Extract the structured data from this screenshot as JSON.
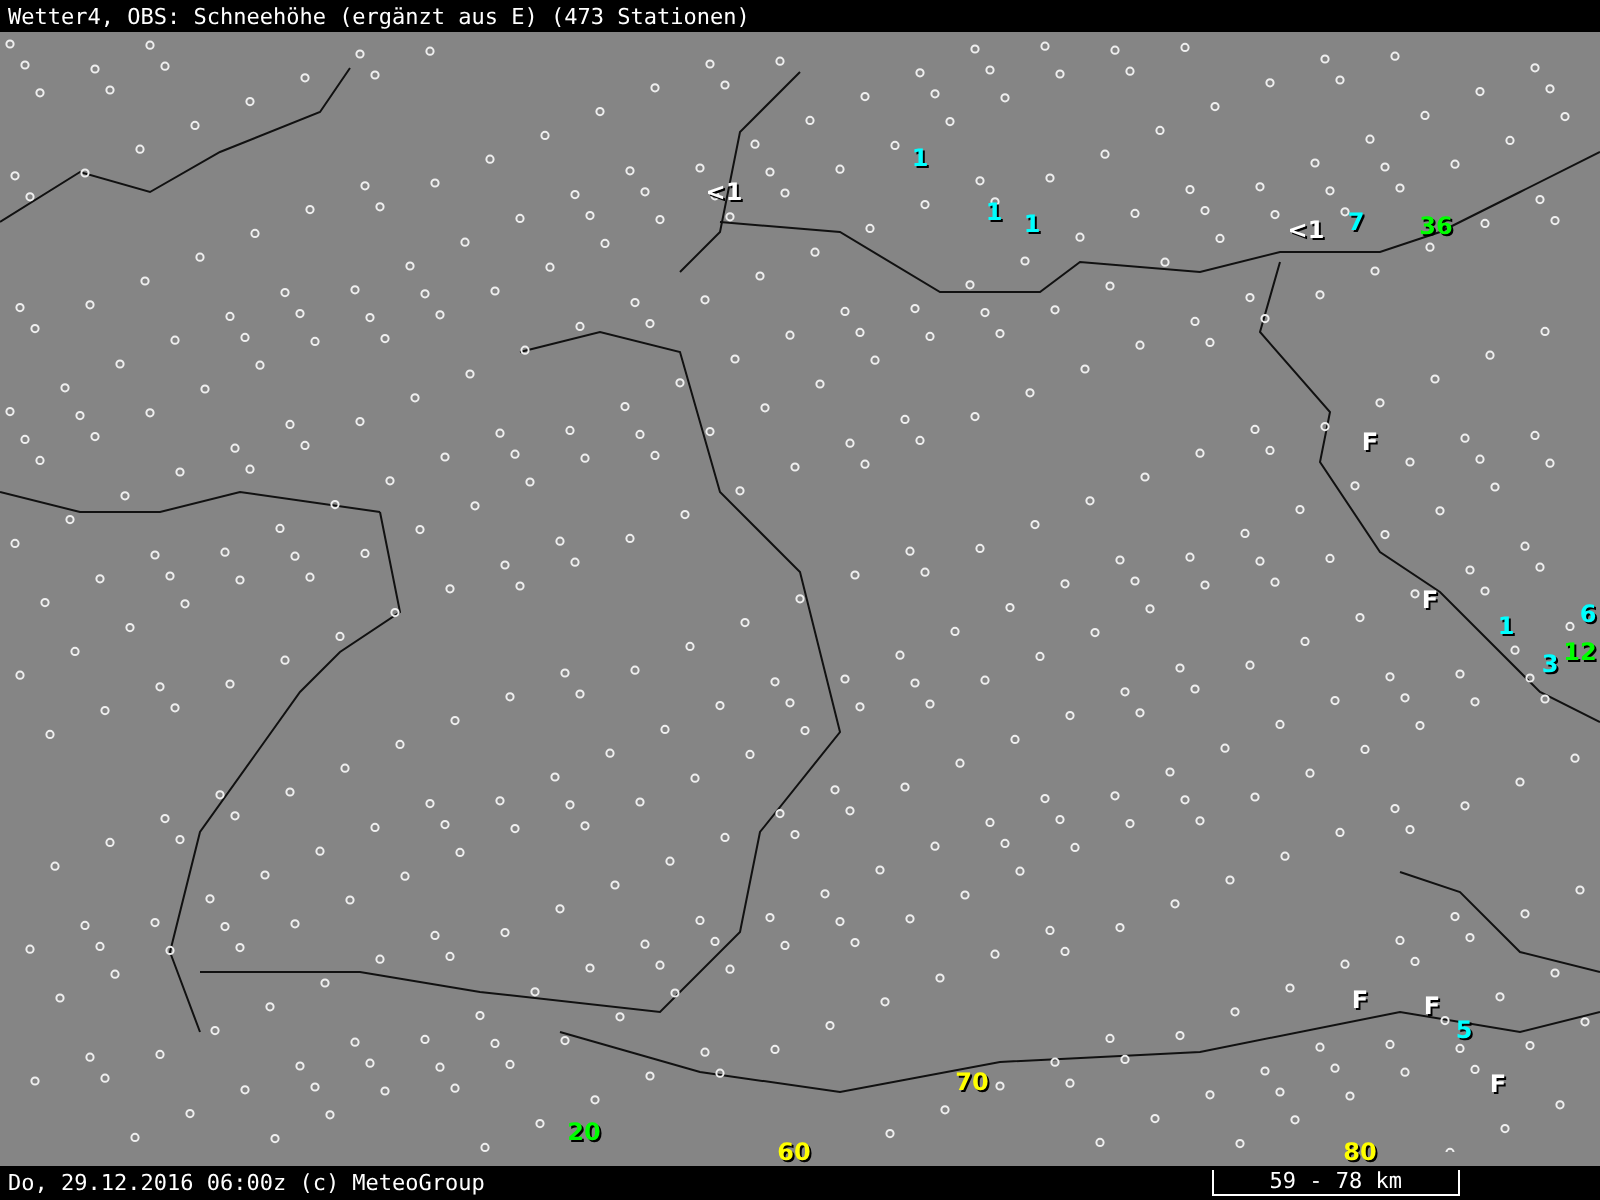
{
  "title_bar": {
    "title": "Wetter4, OBS: Schneehöhe (ergänzt aus E) (473 Stationen)"
  },
  "map": {
    "snow_labels": [
      {
        "text": "<1",
        "color": "#ffffff"
      },
      {
        "text": "1",
        "color": "#00ffff"
      },
      {
        "text": "1",
        "color": "#00ffff"
      },
      {
        "text": "1",
        "color": "#00ffff"
      },
      {
        "text": "<1",
        "color": "#ffffff"
      },
      {
        "text": "7",
        "color": "#00ffff"
      },
      {
        "text": "36",
        "color": "#00ff00"
      },
      {
        "text": "F",
        "color": "#ffffff"
      },
      {
        "text": "F",
        "color": "#ffffff"
      },
      {
        "text": "1",
        "color": "#00ffff"
      },
      {
        "text": "3",
        "color": "#00ffff"
      },
      {
        "text": "6",
        "color": "#00ffff"
      },
      {
        "text": "12",
        "color": "#00ff00"
      },
      {
        "text": "F",
        "color": "#ffffff"
      },
      {
        "text": "F",
        "color": "#ffffff"
      },
      {
        "text": "5",
        "color": "#00ffff"
      },
      {
        "text": "F",
        "color": "#ffffff"
      },
      {
        "text": "70",
        "color": "#ffff00"
      },
      {
        "text": "20",
        "color": "#00ff00"
      },
      {
        "text": "60",
        "color": "#ffff00"
      },
      {
        "text": "80",
        "color": "#ffff00"
      }
    ]
  },
  "status_bar": {
    "caption": "Do, 29.12.2016 06:00z (c) MeteoGroup",
    "scale": "59 - 78 km"
  }
}
